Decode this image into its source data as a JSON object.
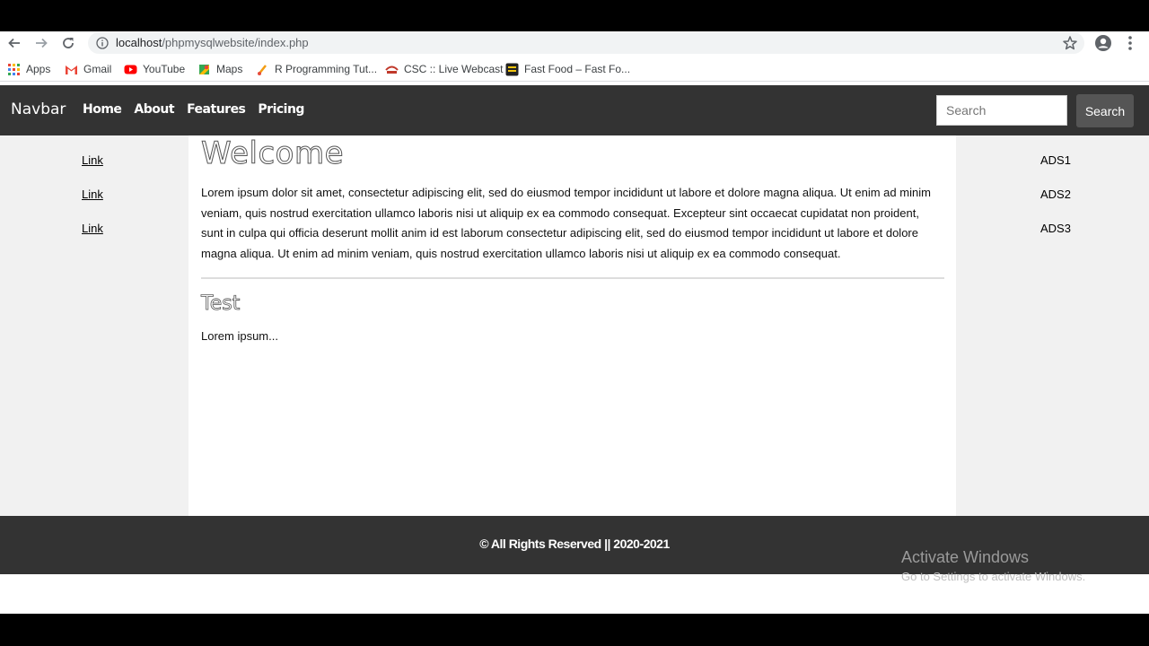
{
  "browser": {
    "url_host": "localhost",
    "url_path": "/phpmysqlwebsite/index.php",
    "bookmarks": [
      {
        "label": "Apps",
        "icon": "apps-grid-icon"
      },
      {
        "label": "Gmail",
        "icon": "gmail-icon"
      },
      {
        "label": "YouTube",
        "icon": "youtube-icon"
      },
      {
        "label": "Maps",
        "icon": "maps-icon"
      },
      {
        "label": "R Programming Tut...",
        "icon": "r-programming-icon"
      },
      {
        "label": "CSC :: Live Webcast",
        "icon": "csc-icon"
      },
      {
        "label": "Fast Food – Fast Fo...",
        "icon": "fast-food-icon"
      }
    ]
  },
  "navbar": {
    "brand": "Navbar",
    "links": [
      "Home",
      "About",
      "Features",
      "Pricing"
    ],
    "search_placeholder": "Search",
    "search_button": "Search"
  },
  "sidebar_left": {
    "links": [
      "Link",
      "Link",
      "Link"
    ]
  },
  "main": {
    "title": "Welcome",
    "paragraph": "Lorem ipsum dolor sit amet, consectetur adipiscing elit, sed do eiusmod tempor incididunt ut labore et dolore magna aliqua. Ut enim ad minim veniam, quis nostrud exercitation ullamco laboris nisi ut aliquip ex ea commodo consequat. Excepteur sint occaecat cupidatat non proident, sunt in culpa qui officia deserunt mollit anim id est laborum consectetur adipiscing elit, sed do eiusmod tempor incididunt ut labore et dolore magna aliqua. Ut enim ad minim veniam, quis nostrud exercitation ullamco laboris nisi ut aliquip ex ea commodo consequat.",
    "subtitle": "Test",
    "subparagraph": "Lorem ipsum..."
  },
  "sidebar_right": {
    "ads": [
      "ADS1",
      "ADS2",
      "ADS3"
    ]
  },
  "footer": {
    "text": "© All Rights Reserved || 2020-2021"
  },
  "watermark": {
    "title": "Activate Windows",
    "subtitle": "Go to Settings to activate Windows."
  }
}
